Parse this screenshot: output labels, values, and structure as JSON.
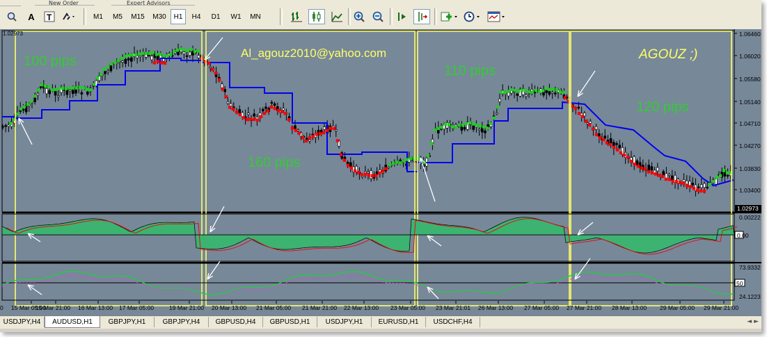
{
  "toolbar": {
    "top_labels": [
      "New Order",
      "Expert Advisors"
    ],
    "timeframes": [
      "M1",
      "M5",
      "M15",
      "M30",
      "H1",
      "H4",
      "D1",
      "W1",
      "MN"
    ],
    "active_timeframe": "H1"
  },
  "chart": {
    "symbol_price": "1.02973",
    "price_axis": [
      "1.06460",
      "1.06020",
      "1.05580",
      "1.05140",
      "1.04710",
      "1.04270",
      "1.03830",
      "1.03400"
    ],
    "current_price": "1.02973",
    "annotations": {
      "email": "Al_agouz2010@yahoo.com",
      "brand": "AGOUZ ;)",
      "pips_100": "100 pips",
      "pips_160": "160 pips",
      "pips_110": "110 pips",
      "pips_120": "120 pips"
    },
    "macd_axis": [
      "0.00222",
      "0.00"
    ],
    "rsi_axis": [
      "73.9332",
      "50",
      "24.1223"
    ],
    "time_axis": [
      "15 Mar 05:00",
      "15 Mar 21:00",
      "16 Mar 13:00",
      "17 Mar 05:00",
      "19 Mar 21:00",
      "20 Mar 13:00",
      "21 Mar 05:00",
      "21 Mar 21:00",
      "22 Mar 13:00",
      "23 Mar 05:00",
      "23 Mar 21:01",
      "26 Mar 13:00",
      "27 Mar 05:00",
      "27 Mar 21:00",
      "28 Mar 13:00",
      "29 Mar 05:00",
      "29 Mar 21:00"
    ],
    "time_axis_first": "0",
    "colors": {
      "background": "#778899",
      "bull_tick": "#22cc22",
      "bear_tick": "#ff0000",
      "signal_line": "#0000ee",
      "frame_lines": "#ffff66",
      "pips_text": "#33cc33"
    }
  },
  "tabs": [
    "USDJPY,H4",
    "AUDUSD,H1",
    "GBPJPY,H1",
    "GBPJPY,H4",
    "GBPUSD,H4",
    "GBPUSD,H1",
    "USDJPY,H1",
    "EURUSD,H1",
    "USDCHF,H4"
  ],
  "active_tab": "AUDUSD,H1"
}
